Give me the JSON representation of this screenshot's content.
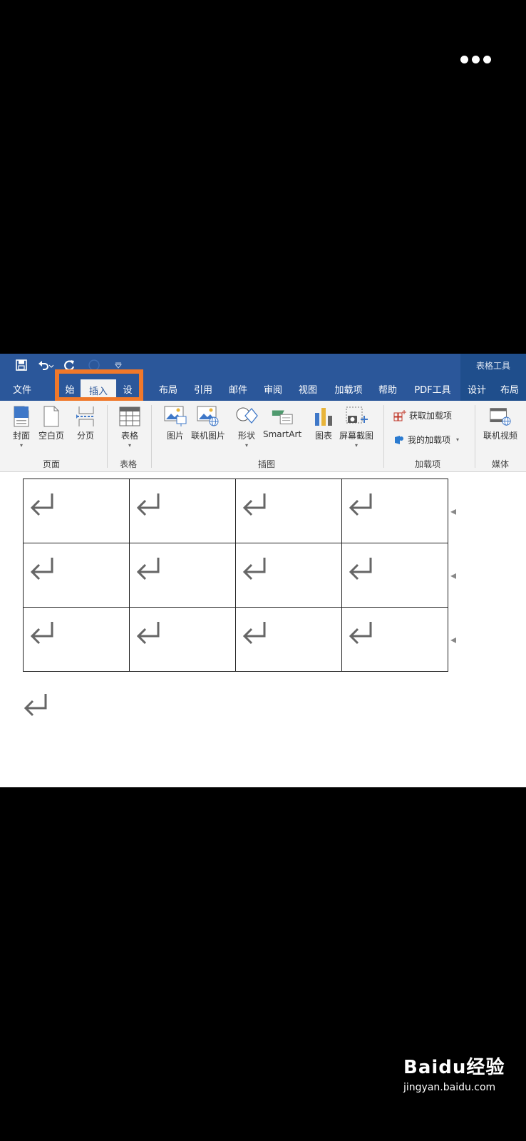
{
  "quick_access": {
    "save_icon": "save-icon",
    "undo_icon": "undo-icon",
    "redo_icon": "redo-icon",
    "customize_icon": "customize-arrow-icon"
  },
  "context_header": "表格工具",
  "tabs": [
    {
      "label": "文件"
    },
    {
      "label": "始"
    },
    {
      "label": "插入",
      "active": true
    },
    {
      "label": "设"
    },
    {
      "label": "布局"
    },
    {
      "label": "引用"
    },
    {
      "label": "邮件"
    },
    {
      "label": "审阅"
    },
    {
      "label": "视图"
    },
    {
      "label": "加载项"
    },
    {
      "label": "帮助"
    },
    {
      "label": "PDF工具"
    },
    {
      "label": "设计"
    },
    {
      "label": "布局"
    }
  ],
  "ribbon": {
    "pages": {
      "cover": "封面",
      "blank": "空白页",
      "break": "分页",
      "group": "页面"
    },
    "tables": {
      "table": "表格",
      "group": "表格"
    },
    "illustrations": {
      "picture": "图片",
      "online_picture": "联机图片",
      "shapes": "形状",
      "smartart": "SmartArt",
      "chart": "图表",
      "screenshot": "屏幕截图",
      "group": "插图"
    },
    "addins": {
      "get": "获取加载项",
      "mine": "我的加载项",
      "group": "加载项"
    },
    "media": {
      "online_video": "联机视频",
      "group": "媒体"
    }
  },
  "document": {
    "table_rows": 3,
    "table_cols": 4
  },
  "watermark": {
    "logo": "Baidu经验",
    "url": "jingyan.baidu.com"
  },
  "colors": {
    "ribbon_blue": "#2b579a",
    "highlight": "#f0782a"
  }
}
